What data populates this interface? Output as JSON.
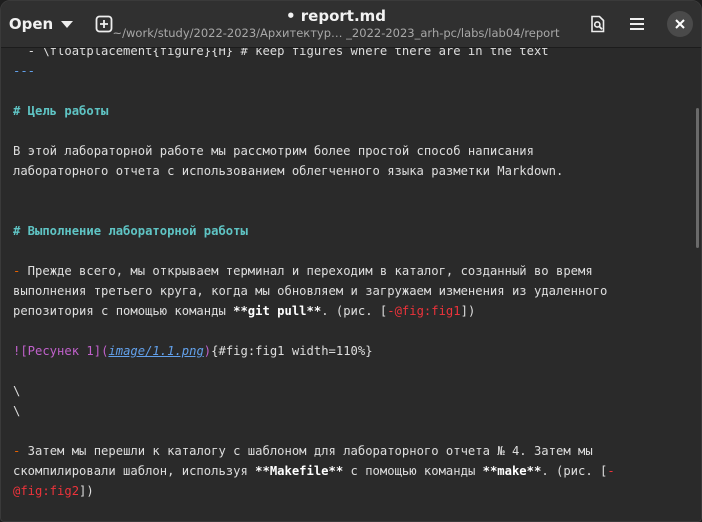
{
  "header": {
    "open_label": "Open",
    "title": "• report.md",
    "subtitle": "~/work/study/2022-2023/Архитектур… _2022-2023_arh-pc/labs/lab04/report"
  },
  "editor": {
    "line_top": "  - \\floatplacement{figure}{H} # keep figures where there are in the text",
    "hr": "---",
    "heading1": "# Цель работы",
    "para1_line1": "В этой лабораторной работе мы рассмотрим более простой способ написания",
    "para1_line2": "лабораторного отчета с использованием облегченного языка разметки Markdown.",
    "heading2": "# Выполнение лабораторной работы",
    "item1": {
      "dash": "-",
      "line1": " Прежде всего, мы открываем терминал и переходим в каталог, созданный во время",
      "line2": "выполнения третьего круга, когда мы обновляем и загружаем изменения из удаленного",
      "line3_pre": "репозитория с помощью команды ",
      "line3_bold": "**git pull**",
      "line3_mid": ". (рис. [",
      "line3_ref": "-@fig:fig1",
      "line3_post": "])"
    },
    "image": {
      "link_text": "![Ресунек 1]",
      "url": "image/1.1.png",
      "attrs": "{#fig:fig1 width=110%}"
    },
    "backslash1": "\\",
    "backslash2": "\\",
    "item2": {
      "dash": "-",
      "line1": " Затем мы перешли к каталогу с шаблоном для лабораторного отчета № 4. Затем мы",
      "line2_pre": "скомпилировали шаблон, используя ",
      "line2_bold1": "**Makefile**",
      "line2_mid": " с помощью команды ",
      "line2_bold2": "**make**",
      "line2_post": ". (рис. [",
      "line2_ref": "-",
      "line3_ref": "@fig:fig2",
      "line3_post": "])"
    }
  }
}
